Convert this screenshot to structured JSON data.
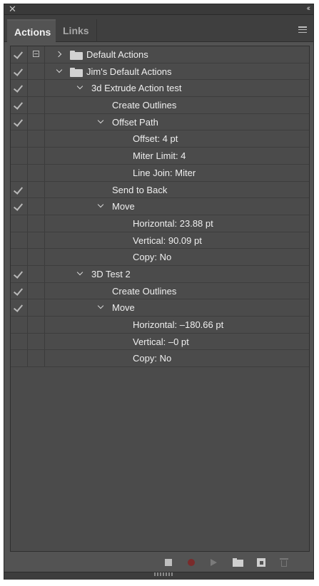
{
  "panel": {
    "close_glyph": "✕",
    "collapse_glyph": "‹‹",
    "tabs": [
      {
        "label": "Actions"
      },
      {
        "label": "Links"
      }
    ],
    "menu_icon": "hamburger-menu-icon"
  },
  "rows": [
    {
      "checked": true,
      "dialog": true,
      "indent": 0,
      "chevron": "right",
      "folder": true,
      "label": "Default Actions"
    },
    {
      "checked": true,
      "dialog": false,
      "indent": 0,
      "chevron": "down",
      "folder": true,
      "label": "Jim's Default Actions"
    },
    {
      "checked": true,
      "dialog": false,
      "indent": 1,
      "chevron": "down",
      "folder": false,
      "label": "3d Extrude Action test"
    },
    {
      "checked": true,
      "dialog": false,
      "indent": 2,
      "chevron": null,
      "folder": false,
      "label": "Create Outlines"
    },
    {
      "checked": true,
      "dialog": false,
      "indent": 2,
      "chevron": "down",
      "folder": false,
      "label": "Offset Path"
    },
    {
      "checked": false,
      "dialog": false,
      "indent": 3,
      "chevron": null,
      "folder": false,
      "label": "Offset: 4 pt"
    },
    {
      "checked": false,
      "dialog": false,
      "indent": 3,
      "chevron": null,
      "folder": false,
      "label": "Miter Limit: 4"
    },
    {
      "checked": false,
      "dialog": false,
      "indent": 3,
      "chevron": null,
      "folder": false,
      "label": "Line Join: Miter"
    },
    {
      "checked": true,
      "dialog": false,
      "indent": 2,
      "chevron": null,
      "folder": false,
      "label": "Send to Back"
    },
    {
      "checked": true,
      "dialog": false,
      "indent": 2,
      "chevron": "down",
      "folder": false,
      "label": "Move"
    },
    {
      "checked": false,
      "dialog": false,
      "indent": 3,
      "chevron": null,
      "folder": false,
      "label": "Horizontal: 23.88 pt"
    },
    {
      "checked": false,
      "dialog": false,
      "indent": 3,
      "chevron": null,
      "folder": false,
      "label": "Vertical: 90.09 pt"
    },
    {
      "checked": false,
      "dialog": false,
      "indent": 3,
      "chevron": null,
      "folder": false,
      "label": "Copy: No"
    },
    {
      "checked": true,
      "dialog": false,
      "indent": 1,
      "chevron": "down",
      "folder": false,
      "label": "3D Test 2"
    },
    {
      "checked": true,
      "dialog": false,
      "indent": 2,
      "chevron": null,
      "folder": false,
      "label": "Create Outlines"
    },
    {
      "checked": true,
      "dialog": false,
      "indent": 2,
      "chevron": "down",
      "folder": false,
      "label": "Move"
    },
    {
      "checked": false,
      "dialog": false,
      "indent": 3,
      "chevron": null,
      "folder": false,
      "label": "Horizontal: –180.66 pt"
    },
    {
      "checked": false,
      "dialog": false,
      "indent": 3,
      "chevron": null,
      "folder": false,
      "label": "Vertical: –0 pt"
    },
    {
      "checked": false,
      "dialog": false,
      "indent": 3,
      "chevron": null,
      "folder": false,
      "label": "Copy: No"
    }
  ],
  "footer": {
    "buttons": [
      "stop-playing-icon",
      "begin-recording-icon",
      "play-selection-icon",
      "create-new-set-icon",
      "create-new-action-icon",
      "delete-selection-icon"
    ]
  },
  "colors": {
    "panel_bg": "#535353",
    "list_bg": "#4b4b4b",
    "text": "#efefef",
    "record": "#7a2b2b"
  }
}
